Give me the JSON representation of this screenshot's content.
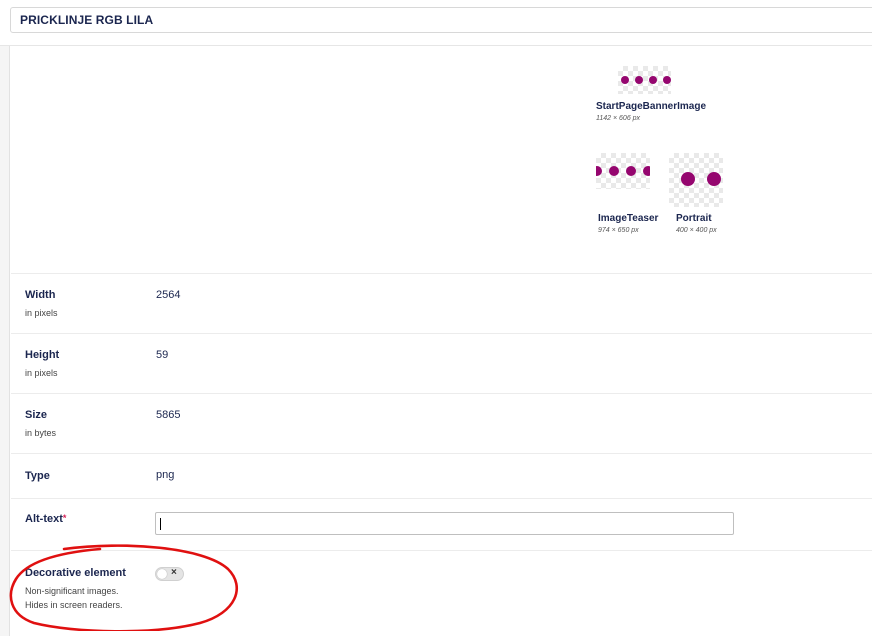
{
  "header": {
    "title": "PRICKLINJE RGB LILA"
  },
  "crops": [
    {
      "name": "StartPageBannerImage",
      "dims": "1142 × 606 px"
    },
    {
      "name": "ImageTeaser",
      "dims": "974 × 650 px"
    },
    {
      "name": "Portrait",
      "dims": "400 × 400 px"
    }
  ],
  "properties": [
    {
      "label": "Width",
      "description": "in pixels",
      "value": "2564"
    },
    {
      "label": "Height",
      "description": "in pixels",
      "value": "59"
    },
    {
      "label": "Size",
      "description": "in bytes",
      "value": "5865"
    },
    {
      "label": "Type",
      "description": "",
      "value": "png"
    }
  ],
  "alt_text": {
    "label": "Alt-text",
    "required_marker": "*",
    "value": ""
  },
  "decorative": {
    "label": "Decorative element",
    "description_line1": "Non-significant images.",
    "description_line2": "Hides in screen readers.",
    "toggle_on": false,
    "toggle_symbol": "×"
  },
  "colors": {
    "accent_purple": "#95066f",
    "annotation_red": "#e01010",
    "text_navy": "#1b264f"
  }
}
